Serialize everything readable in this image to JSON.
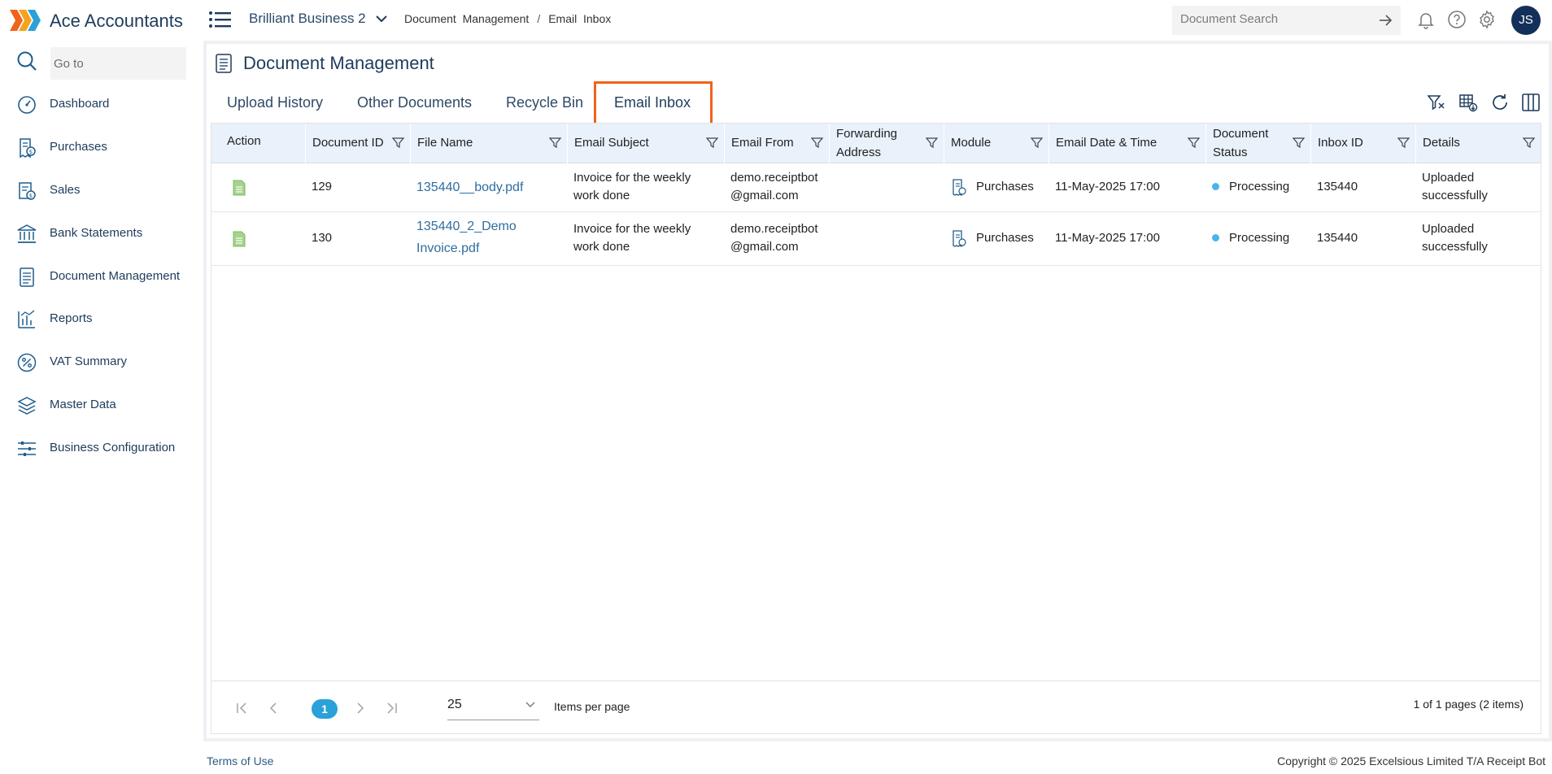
{
  "app": {
    "title": "Ace Accountants",
    "user_initials": "JS"
  },
  "header": {
    "business_name": "Brilliant Business 2",
    "breadcrumb": [
      "Document  Management",
      "Email  Inbox"
    ],
    "breadcrumb_separator": "/",
    "search_placeholder": "Document Search"
  },
  "sidebar": {
    "goto_placeholder": "Go to",
    "items": [
      {
        "label": "Dashboard",
        "icon": "dashboard-gauge-icon"
      },
      {
        "label": "Purchases",
        "icon": "purchases-receipt-icon"
      },
      {
        "label": "Sales",
        "icon": "sales-receipt-icon"
      },
      {
        "label": "Bank Statements",
        "icon": "bank-icon"
      },
      {
        "label": "Document Management",
        "icon": "document-icon"
      },
      {
        "label": "Reports",
        "icon": "reports-chart-icon"
      },
      {
        "label": "VAT Summary",
        "icon": "percent-icon"
      },
      {
        "label": "Master Data",
        "icon": "layers-icon"
      },
      {
        "label": "Business Configuration",
        "icon": "sliders-icon"
      }
    ]
  },
  "page": {
    "title": "Document Management",
    "tabs": [
      "Upload History",
      "Other Documents",
      "Recycle Bin",
      "Email Inbox"
    ],
    "active_tab": "Email Inbox"
  },
  "grid": {
    "columns": [
      {
        "line1": "Action",
        "line2": ""
      },
      {
        "line1": "Document ID",
        "line2": ""
      },
      {
        "line1": "File Name",
        "line2": ""
      },
      {
        "line1": "Email Subject",
        "line2": ""
      },
      {
        "line1": "Email From",
        "line2": ""
      },
      {
        "line1": "Forwarding",
        "line2": "Address"
      },
      {
        "line1": "Module",
        "line2": ""
      },
      {
        "line1": "Email Date & Time",
        "line2": ""
      },
      {
        "line1": "Document",
        "line2": "Status"
      },
      {
        "line1": "Inbox ID",
        "line2": ""
      },
      {
        "line1": "Details",
        "line2": ""
      }
    ],
    "rows": [
      {
        "document_id": "129",
        "file_name_1": "135440__body.pdf",
        "file_name_2": "",
        "subject_1": "Invoice for the weekly",
        "subject_2": "work done",
        "from_1": "demo.receiptbot",
        "from_2": "@gmail.com",
        "forwarding": "",
        "module": "Purchases",
        "date_time": "11-May-2025 17:00",
        "status": "Processing",
        "inbox_id": "135440",
        "details_1": "Uploaded",
        "details_2": "successfully"
      },
      {
        "document_id": "130",
        "file_name_1": "135440_2_Demo",
        "file_name_2": "Invoice.pdf",
        "subject_1": "Invoice for the weekly",
        "subject_2": "work done",
        "from_1": "demo.receiptbot",
        "from_2": "@gmail.com",
        "forwarding": "",
        "module": "Purchases",
        "date_time": "11-May-2025 17:00",
        "status": "Processing",
        "inbox_id": "135440",
        "details_1": "Uploaded",
        "details_2": "successfully"
      }
    ]
  },
  "pager": {
    "current_page": "1",
    "page_size": "25",
    "items_per_page_label": "Items per page",
    "info": "1 of 1 pages (2 items)"
  },
  "footer": {
    "terms": "Terms of Use",
    "copyright": "Copyright © 2025 Excelsious Limited T/A Receipt Bot"
  },
  "colors": {
    "accent": "#1e3b5c",
    "active_tab_highlight": "#f0631d",
    "status_dot": "#4bb3ea",
    "page_pill": "#2aa1d8",
    "header_bg": "#e9f1fb"
  }
}
